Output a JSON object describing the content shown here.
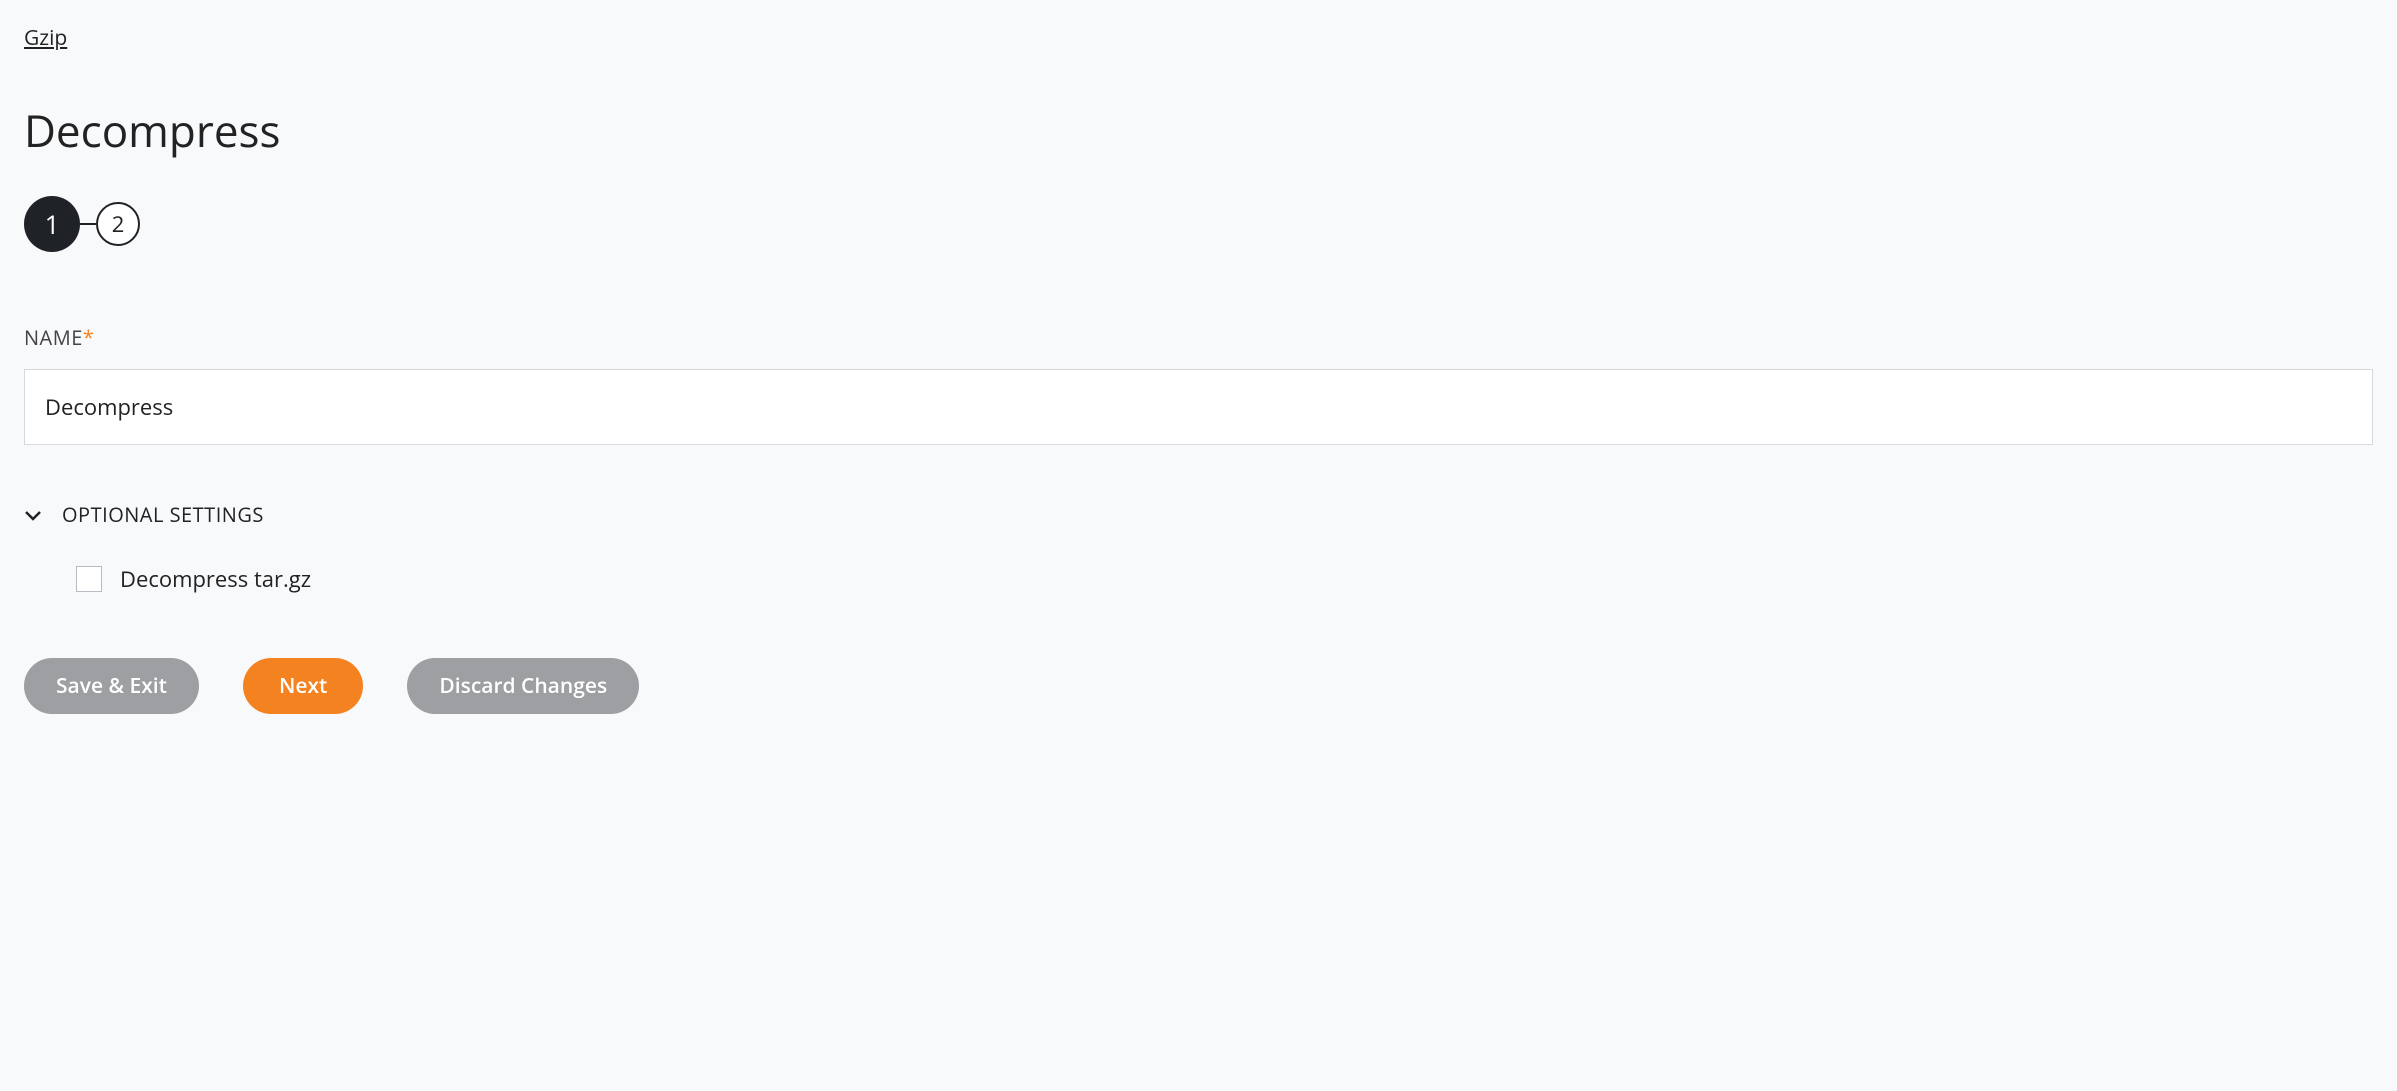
{
  "breadcrumb": "Gzip",
  "page_title": "Decompress",
  "stepper": {
    "steps": [
      "1",
      "2"
    ],
    "active_index": 0
  },
  "form": {
    "name_label": "NAME",
    "name_value": "Decompress"
  },
  "optional": {
    "header_label": "OPTIONAL SETTINGS",
    "expanded": true,
    "checkbox_label": "Decompress tar.gz",
    "checkbox_checked": false
  },
  "buttons": {
    "save_exit": "Save & Exit",
    "next": "Next",
    "discard": "Discard Changes"
  }
}
